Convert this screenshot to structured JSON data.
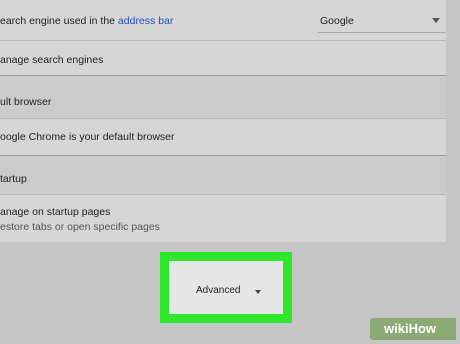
{
  "search_engine": {
    "label_prefix": "earch engine used in the ",
    "label_link": "address bar",
    "selected": "Google"
  },
  "manage_search": {
    "label": "anage search engines"
  },
  "default_browser": {
    "section_title": "ult browser",
    "status": "oogle Chrome is your default browser"
  },
  "startup": {
    "section_title": "tartup",
    "option_label": "anage on startup pages",
    "option_sub": "estore tabs or open specific pages"
  },
  "advanced_button": {
    "label": "Advanced"
  },
  "watermark": {
    "text": "wikiHow"
  },
  "colors": {
    "highlight": "#2ee82e",
    "link": "#2a4eb3",
    "background": "#c6c6c6",
    "panel": "#d6d6d6"
  }
}
